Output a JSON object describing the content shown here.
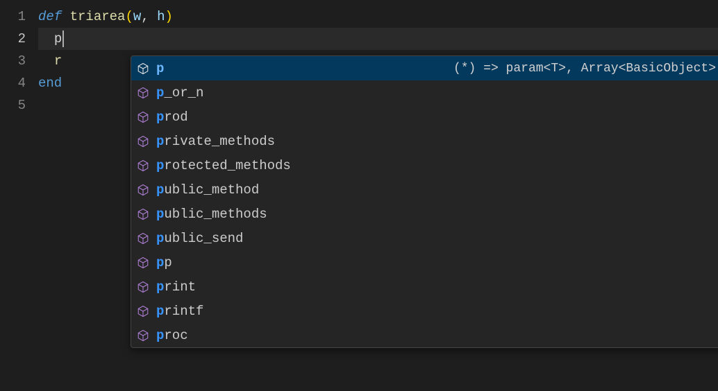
{
  "code": {
    "lines": [
      {
        "n": "1",
        "kind": "def",
        "def": "def",
        "fn": "triarea",
        "open": "(",
        "p1": "w",
        "comma": ", ",
        "p2": "h",
        "close": ")"
      },
      {
        "n": "2",
        "kind": "cur",
        "indent": "  ",
        "ch": "p"
      },
      {
        "n": "3",
        "kind": "ret",
        "indent": "  ",
        "r": "r"
      },
      {
        "n": "4",
        "kind": "end",
        "end": "end"
      },
      {
        "n": "5",
        "kind": "blank"
      }
    ]
  },
  "suggest": {
    "selected_index": 0,
    "items": [
      {
        "prefix": "p",
        "rest": "",
        "detail": "(*) => param<T>, Array<BasicObject>"
      },
      {
        "prefix": "p",
        "rest": "_or_n",
        "detail": ""
      },
      {
        "prefix": "p",
        "rest": "rod",
        "detail": ""
      },
      {
        "prefix": "p",
        "rest": "rivate_methods",
        "detail": ""
      },
      {
        "prefix": "p",
        "rest": "rotected_methods",
        "detail": ""
      },
      {
        "prefix": "p",
        "rest": "ublic_method",
        "detail": ""
      },
      {
        "prefix": "p",
        "rest": "ublic_methods",
        "detail": ""
      },
      {
        "prefix": "p",
        "rest": "ublic_send",
        "detail": ""
      },
      {
        "prefix": "p",
        "rest": "p",
        "detail": ""
      },
      {
        "prefix": "p",
        "rest": "rint",
        "detail": ""
      },
      {
        "prefix": "p",
        "rest": "rintf",
        "detail": ""
      },
      {
        "prefix": "p",
        "rest": "roc",
        "detail": ""
      }
    ]
  }
}
